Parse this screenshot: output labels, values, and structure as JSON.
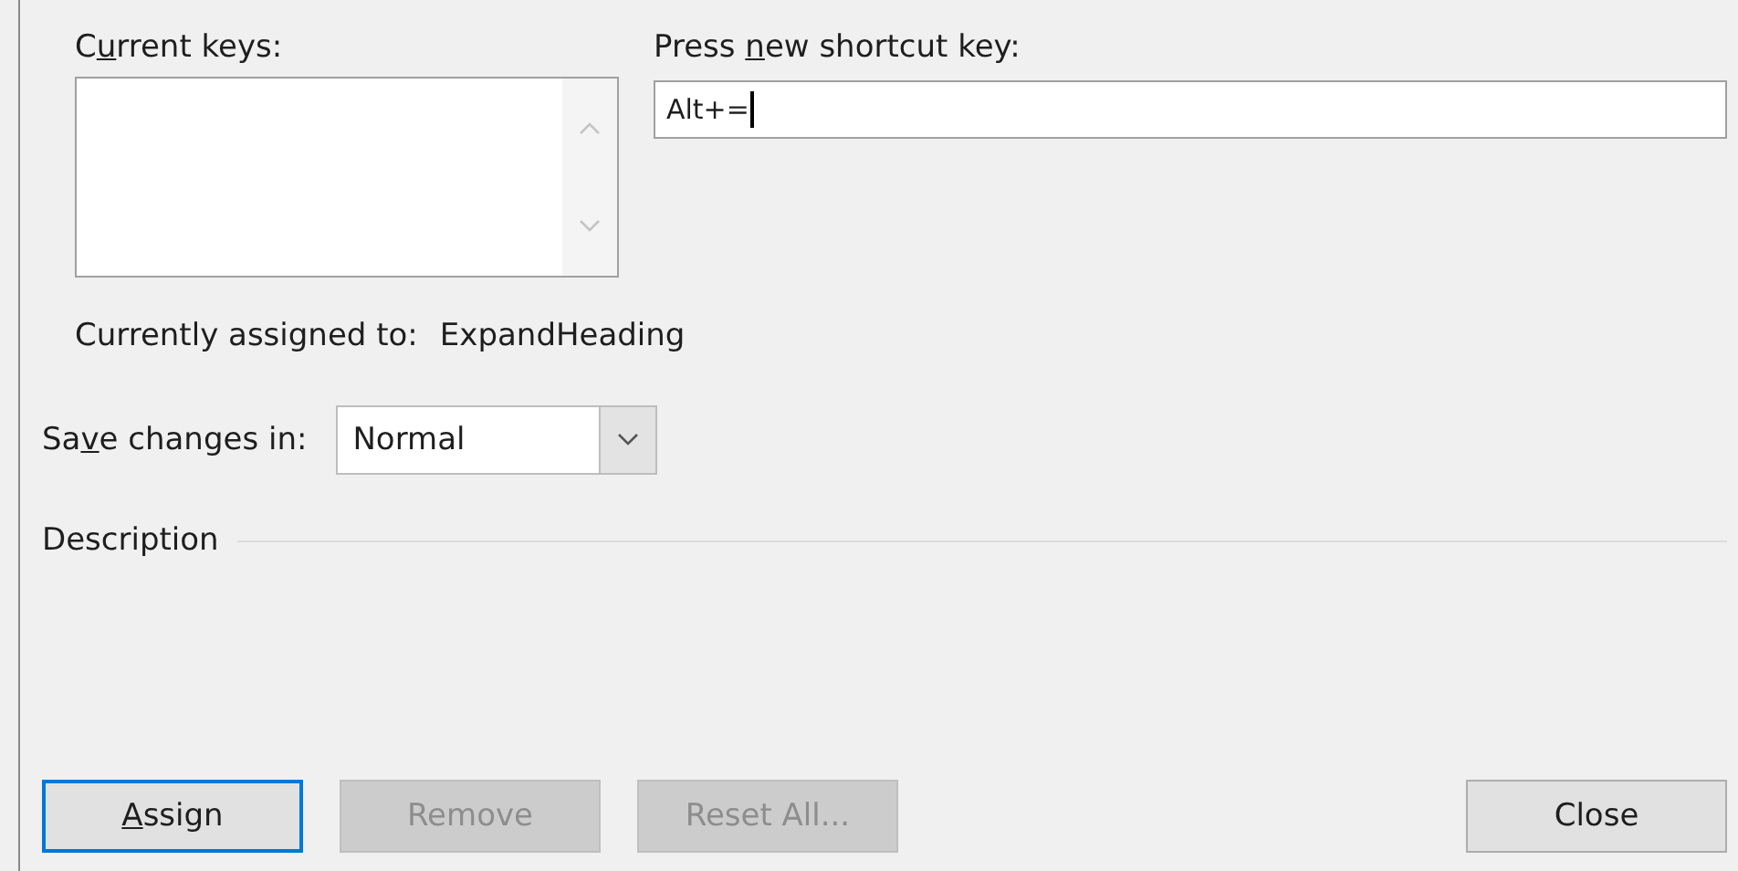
{
  "current_keys": {
    "label": {
      "before": "C",
      "access_key": "u",
      "after": "rrent keys:"
    }
  },
  "new_shortcut": {
    "label": {
      "before": "Press ",
      "access_key": "n",
      "after": "ew shortcut key:"
    },
    "value": "Alt+="
  },
  "assignment": {
    "label": "Currently assigned to:",
    "value": "ExpandHeading"
  },
  "save_changes": {
    "label": {
      "before": "Sa",
      "access_key": "v",
      "after": "e changes in:"
    },
    "value": "Normal"
  },
  "description": {
    "label": "Description"
  },
  "buttons": [
    {
      "label": {
        "access_key": "A",
        "after": "ssign"
      },
      "disabled": false,
      "focused": true
    },
    {
      "label": {
        "before": "Remove"
      },
      "disabled": true,
      "focused": false
    },
    {
      "label": {
        "before": "Reset All..."
      },
      "disabled": true,
      "focused": false
    },
    {
      "label": {
        "before": "Close"
      },
      "disabled": false,
      "focused": false
    }
  ]
}
